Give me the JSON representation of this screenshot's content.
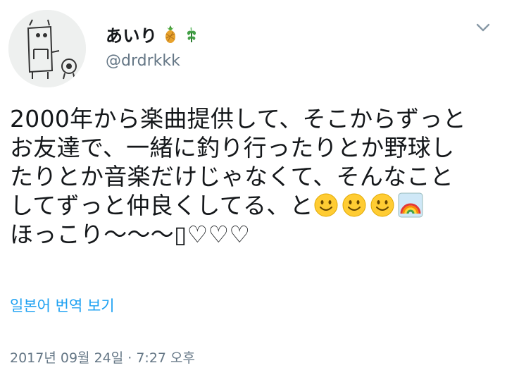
{
  "user": {
    "display_name": "あいり",
    "handle": "@drdrkkk",
    "name_emojis": [
      "pineapple-icon",
      "herb-icon"
    ]
  },
  "tweet": {
    "lines": [
      "2000年から楽曲提供して、そこからずっと",
      "お友達で、一緒に釣り行ったりとか野球し",
      "たりとか音楽だけじゃなくて、そんなこと",
      "してずっと仲良くしてる、と",
      "ほっこり〜〜〜"
    ],
    "line4_emojis": [
      "smiley-icon",
      "smiley-icon",
      "smiley-icon",
      "rainbow-icon"
    ],
    "line5_suffix": "▯♡♡♡"
  },
  "translate_label": "일본어 번역 보기",
  "timestamp": "2017년 09월 24일 · 7:27 오후",
  "colors": {
    "text": "#14171a",
    "secondary": "#657786",
    "link": "#1da1f2"
  }
}
